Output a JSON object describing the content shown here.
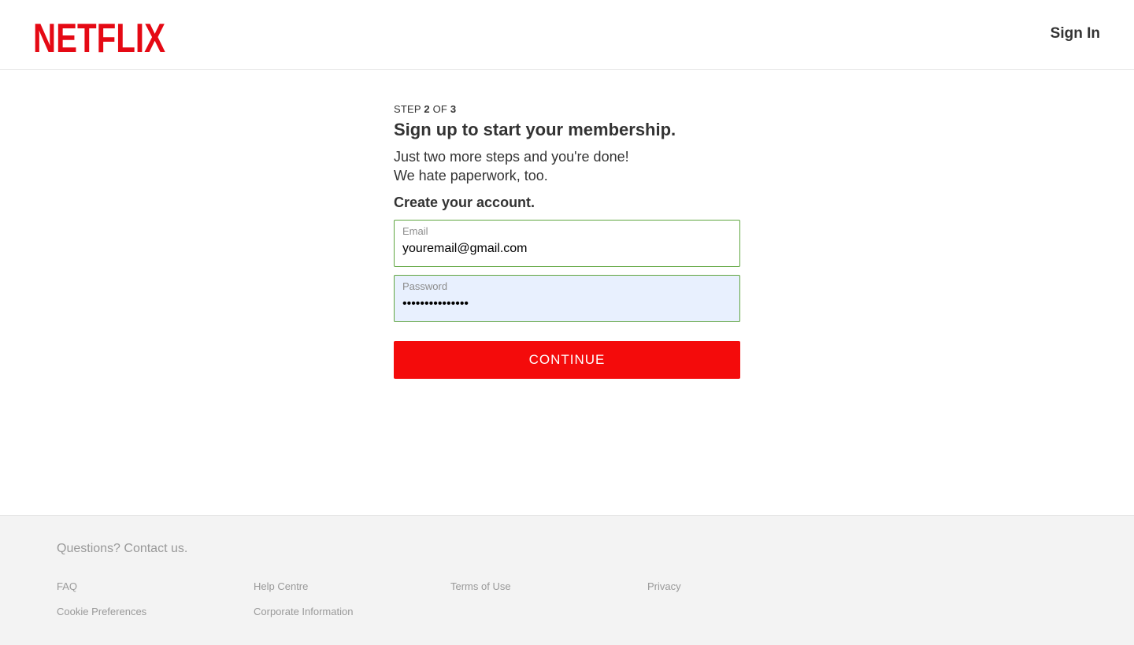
{
  "header": {
    "logo_text": "NETFLIX",
    "signin_label": "Sign In"
  },
  "signup": {
    "step_prefix": "STEP",
    "step_current": "2",
    "step_of": "OF",
    "step_total": "3",
    "title": "Sign up to start your membership.",
    "subtitle_line1": "Just two more steps and you're done!",
    "subtitle_line2": "We hate paperwork, too.",
    "create_heading": "Create your account.",
    "email": {
      "label": "Email",
      "value": "youremail@gmail.com"
    },
    "password": {
      "label": "Password",
      "value": "•••••••••••••••"
    },
    "continue_label": "CONTINUE"
  },
  "footer": {
    "contact": "Questions? Contact us.",
    "links": [
      "FAQ",
      "Help Centre",
      "Terms of Use",
      "Privacy",
      "Cookie Preferences",
      "Corporate Information"
    ]
  },
  "colors": {
    "brand_red": "#e50914",
    "button_red": "#f40b0b",
    "valid_border": "#5fa53f",
    "autofill_bg": "#e8f0fe"
  }
}
